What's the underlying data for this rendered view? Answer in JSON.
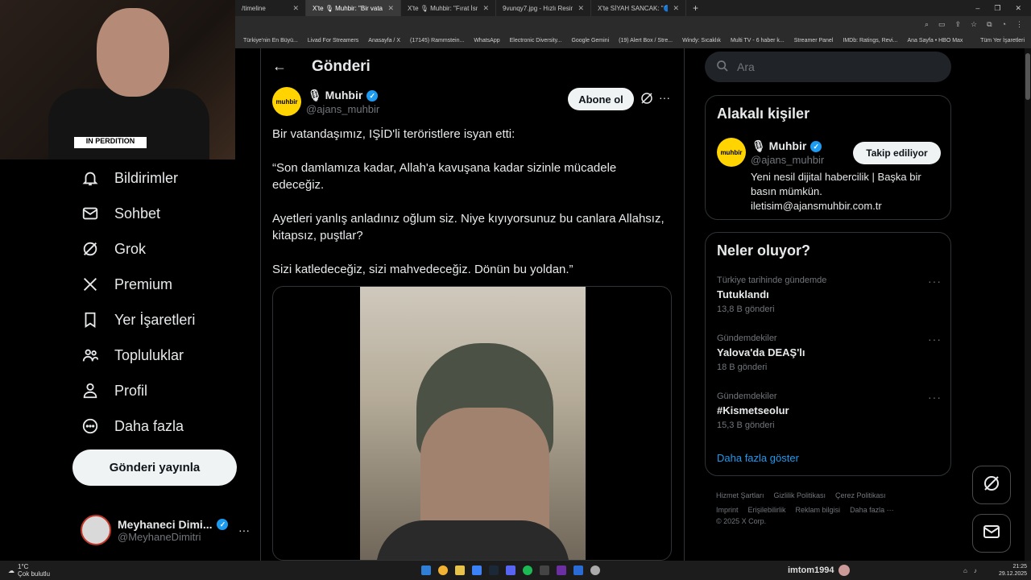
{
  "browser": {
    "tabs": [
      {
        "label": "/timeline",
        "active": false
      },
      {
        "label": "X'te 🎙 Muhbir: \"Bir vatandaşımız...",
        "active": true
      },
      {
        "label": "X'te 🎙 Muhbir: \"Fırat İsmail İlk...",
        "active": false
      },
      {
        "label": "9vunqy7.jpg - Hızlı Resim",
        "active": false
      },
      {
        "label": "X'te SİYAH SANCAK: \"🔵 Yalov...",
        "active": false
      }
    ],
    "bookmarks": [
      "Türkiye'nin En Büyü...",
      "Livad For Streamers",
      "Anasayfa / X",
      "(17145) Rammstein...",
      "WhatsApp",
      "Electronic Diversity...",
      "Google Gemini",
      "(19) Alert Box / Stre...",
      "Windy: Sıcaklık",
      "Multi TV - 6 haber k...",
      "Streamer Panel",
      "IMDb: Ratings, Revi...",
      "Ana Sayfa • HBO Max",
      "Tüm Yer İşaretleri"
    ]
  },
  "webcam": {
    "shirt_text": "IN PERDITION"
  },
  "nav": {
    "items": [
      {
        "label": "Bildirimler",
        "icon": "bell-icon"
      },
      {
        "label": "Sohbet",
        "icon": "mail-icon"
      },
      {
        "label": "Grok",
        "icon": "grok-icon"
      },
      {
        "label": "Premium",
        "icon": "x-logo-icon"
      },
      {
        "label": "Yer İşaretleri",
        "icon": "bookmark-icon"
      },
      {
        "label": "Topluluklar",
        "icon": "people-icon"
      },
      {
        "label": "Profil",
        "icon": "person-icon"
      },
      {
        "label": "Daha fazla",
        "icon": "more-circle-icon"
      }
    ],
    "post_button": "Gönderi yayınla",
    "account": {
      "name": "Meyhaneci Dimi...",
      "handle": "@MeyhaneDimitri",
      "more": "···"
    }
  },
  "post": {
    "header_title": "Gönderi",
    "author_name": "🎙 Muhbir",
    "author_handle": "@ajans_muhbir",
    "logo_text": "muhbir",
    "subscribe": "Abone ol",
    "more": "···",
    "paragraphs": [
      "Bir vatandaşımız, IŞİD'li teröristlere isyan etti:",
      "“Son damlamıza kadar, Allah'a kavuşana kadar sizinle mücadele edeceğiz.",
      "Ayetleri yanlış anladınız oğlum siz. Niye kıyıyorsunuz bu canlara Allahsız, kitapsız, puştlar?",
      "Sizi katledeceğiz, sizi mahvedeceğiz. Dönün bu yoldan.”"
    ]
  },
  "sidebar": {
    "search_placeholder": "Ara",
    "related": {
      "title": "Alakalı kişiler",
      "name": "🎙 Muhbir",
      "handle": "@ajans_muhbir",
      "follow": "Takip ediliyor",
      "bio": "Yeni nesil dijital habercilik | Başka bir basın mümkün. iletisim@ajansmuhbir.com.tr"
    },
    "trends": {
      "title": "Neler oluyor?",
      "items": [
        {
          "meta": "Türkiye tarihinde gündemde",
          "title": "Tutuklandı",
          "count": "13,8 B gönderi"
        },
        {
          "meta": "Gündemdekiler",
          "title": "Yalova'da DEAŞ'lı",
          "count": "18 B gönderi"
        },
        {
          "meta": "Gündemdekiler",
          "title": "#Kismetseolur",
          "count": "15,3 B gönderi"
        }
      ],
      "show_more": "Daha fazla göster"
    },
    "footer": {
      "links": [
        "Hizmet Şartları",
        "Gizlilik Politikası",
        "Çerez Politikası",
        "Imprint",
        "Erişilebilirlik",
        "Reklam bilgisi",
        "Daha fazla ···"
      ],
      "copyright": "© 2025 X Corp."
    }
  },
  "taskbar": {
    "weather_temp": "1°C",
    "weather_desc": "Çok bulutlu",
    "user": "imtom1994",
    "time": "21:25",
    "date": "29.12.2025"
  },
  "colors": {
    "accent": "#1d9bf0",
    "background": "#000000",
    "muhbir_yellow": "#ffd400"
  }
}
